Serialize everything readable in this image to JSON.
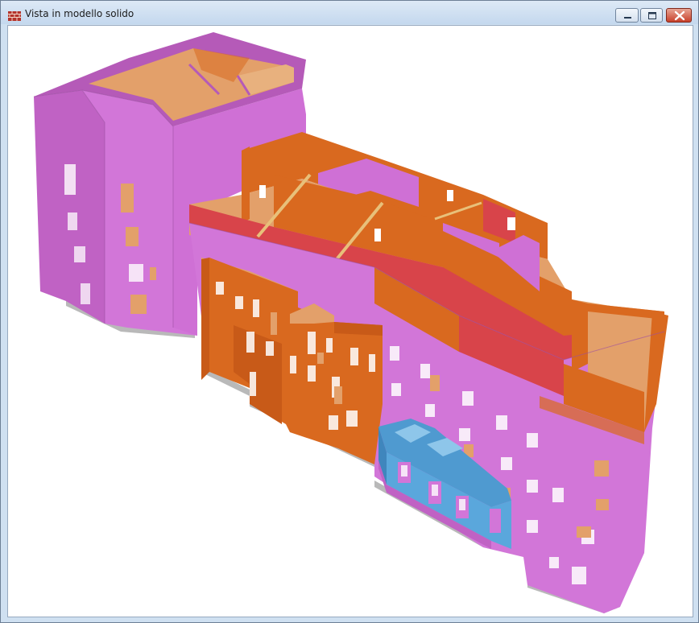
{
  "window": {
    "title": "Vista in modello solido",
    "icon": "brick-wall-icon"
  },
  "controls": {
    "minimize_icon": "minimize-icon",
    "maximize_icon": "maximize-icon",
    "close_icon": "close-icon"
  },
  "model": {
    "description_colors": {
      "masonry_walls": "#cf6fd6",
      "orange_walls": "#d9691f",
      "floor_slabs": "#e3a06a",
      "ring_beams": "#d8444a",
      "balcony_structure": "#4f9ad0",
      "braces": "#e8c07a",
      "foundation": "#b9b9b9"
    }
  }
}
